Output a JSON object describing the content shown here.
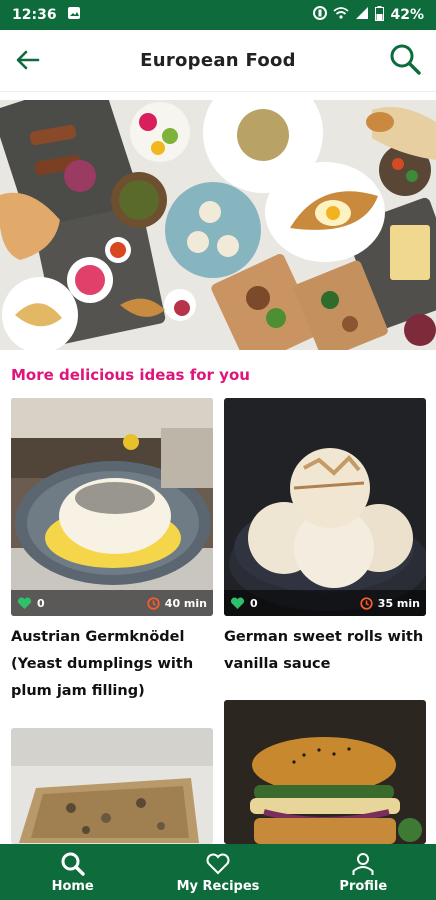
{
  "status_bar": {
    "time": "12:36",
    "battery": "42%"
  },
  "header": {
    "title": "European Food"
  },
  "section_title": "More delicious ideas for you",
  "recipes": [
    {
      "name": "Austrian Germknödel (Yeast dumplings with plum jam filling)",
      "likes": "0",
      "time": "40 min"
    },
    {
      "name": "German sweet rolls with vanilla sauce",
      "likes": "0",
      "time": "35 min"
    }
  ],
  "nav": {
    "home": "Home",
    "my_recipes": "My Recipes",
    "profile": "Profile"
  },
  "colors": {
    "primary": "#0d6b3c",
    "accent": "#e0157a"
  }
}
